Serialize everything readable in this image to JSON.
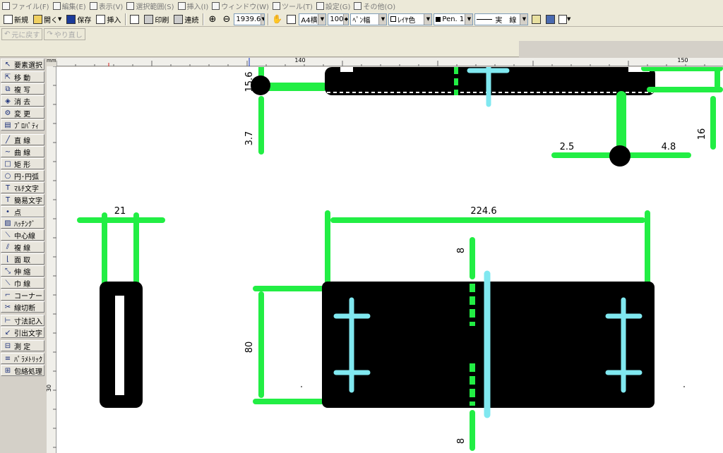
{
  "menu": [
    {
      "label": "ファイル(F)",
      "icon": "file-icon"
    },
    {
      "label": "編集(E)",
      "icon": "edit-icon"
    },
    {
      "label": "表示(V)",
      "icon": "view-icon"
    },
    {
      "label": "選択範囲(S)",
      "icon": "selection-icon"
    },
    {
      "label": "挿入(I)",
      "icon": "insert-icon"
    },
    {
      "label": "ウィンドウ(W)",
      "icon": "window-icon"
    },
    {
      "label": "ツール(T)",
      "icon": "tools-icon"
    },
    {
      "label": "設定(G)",
      "icon": "settings-icon"
    },
    {
      "label": "その他(O)",
      "icon": "other-icon"
    }
  ],
  "toolbar": {
    "new_label": "新規",
    "open_label": "開く",
    "save_label": "保存",
    "insert_label": "挿入",
    "print_label": "印刷",
    "continuous_label": "連続",
    "zoom_value": "1939.6",
    "paper_value": "A4横",
    "scale_value": "100",
    "pen_width_value": "ﾍﾟﾝ幅",
    "layer_color_value": "ﾚｲﾔ色",
    "pen_value": "Pen. 1",
    "line_type_value": "実　線"
  },
  "toolbar2": {
    "undo_label": "元に戻す",
    "redo_label": "やり直し"
  },
  "tools": [
    {
      "label": "要素選択",
      "icon": "arrow-icon",
      "glyph": "↖"
    },
    {
      "label": "移 動",
      "icon": "move-icon",
      "glyph": "⇱"
    },
    {
      "label": "複 写",
      "icon": "copy-icon",
      "glyph": "⧉"
    },
    {
      "label": "消 去",
      "icon": "eraser-icon",
      "glyph": "◈"
    },
    {
      "label": "変 更",
      "icon": "change-icon",
      "glyph": "⚙"
    },
    {
      "label": "ﾌﾟﾛﾊﾟﾃｨ",
      "icon": "property-icon",
      "glyph": "▤"
    },
    {
      "label": "直 線",
      "icon": "line-icon",
      "glyph": "╱"
    },
    {
      "label": "曲 線",
      "icon": "curve-icon",
      "glyph": "∼"
    },
    {
      "label": "矩 形",
      "icon": "rectangle-icon",
      "glyph": "□"
    },
    {
      "label": "円･円弧",
      "icon": "circle-icon",
      "glyph": "○"
    },
    {
      "label": "ﾏﾙﾁ文字",
      "icon": "multi-text-icon",
      "glyph": "T"
    },
    {
      "label": "簡易文字",
      "icon": "simple-text-icon",
      "glyph": "T"
    },
    {
      "label": "点",
      "icon": "point-icon",
      "glyph": "•"
    },
    {
      "label": "ﾊｯﾁﾝｸﾞ",
      "icon": "hatching-icon",
      "glyph": "▨"
    },
    {
      "label": "中心線",
      "icon": "center-line-icon",
      "glyph": "⟍"
    },
    {
      "label": "複 線",
      "icon": "double-line-icon",
      "glyph": "⫽"
    },
    {
      "label": "面 取",
      "icon": "chamfer-icon",
      "glyph": "⌊"
    },
    {
      "label": "伸 縮",
      "icon": "stretch-icon",
      "glyph": "⤡"
    },
    {
      "label": "巾 線",
      "icon": "width-line-icon",
      "glyph": "⟍"
    },
    {
      "label": "コーナー",
      "icon": "corner-icon",
      "glyph": "⌐"
    },
    {
      "label": "線切断",
      "icon": "line-cut-icon",
      "glyph": "✂"
    },
    {
      "label": "寸法記入",
      "icon": "dimension-icon",
      "glyph": "⊢"
    },
    {
      "label": "引出文字",
      "icon": "leader-text-icon",
      "glyph": "↙"
    },
    {
      "label": "測 定",
      "icon": "measure-icon",
      "glyph": "⊟"
    },
    {
      "label": "ﾊﾟﾗﾒﾄﾘｯｸ",
      "icon": "parametric-icon",
      "glyph": "≡"
    },
    {
      "label": "包絡処理",
      "icon": "envelope-icon",
      "glyph": "⊞"
    }
  ],
  "ruler": {
    "unit": "mm",
    "top_labels": [
      "140",
      "150"
    ],
    "left_labels": [
      "30"
    ]
  },
  "dimensions": {
    "d_15_6": "15.6",
    "d_3_7": "3.7",
    "d_2_5": "2.5",
    "d_4_8": "4.8",
    "d_16": "16",
    "d_21": "21",
    "d_224_6": "224.6",
    "d_8_top": "8",
    "d_8_bottom": "8",
    "d_80": "80"
  },
  "colors": {
    "dimension_line": "#22ee44",
    "center_line": "#80e8f0",
    "shape_fill": "#000000",
    "canvas_bg": "#ffffff"
  }
}
